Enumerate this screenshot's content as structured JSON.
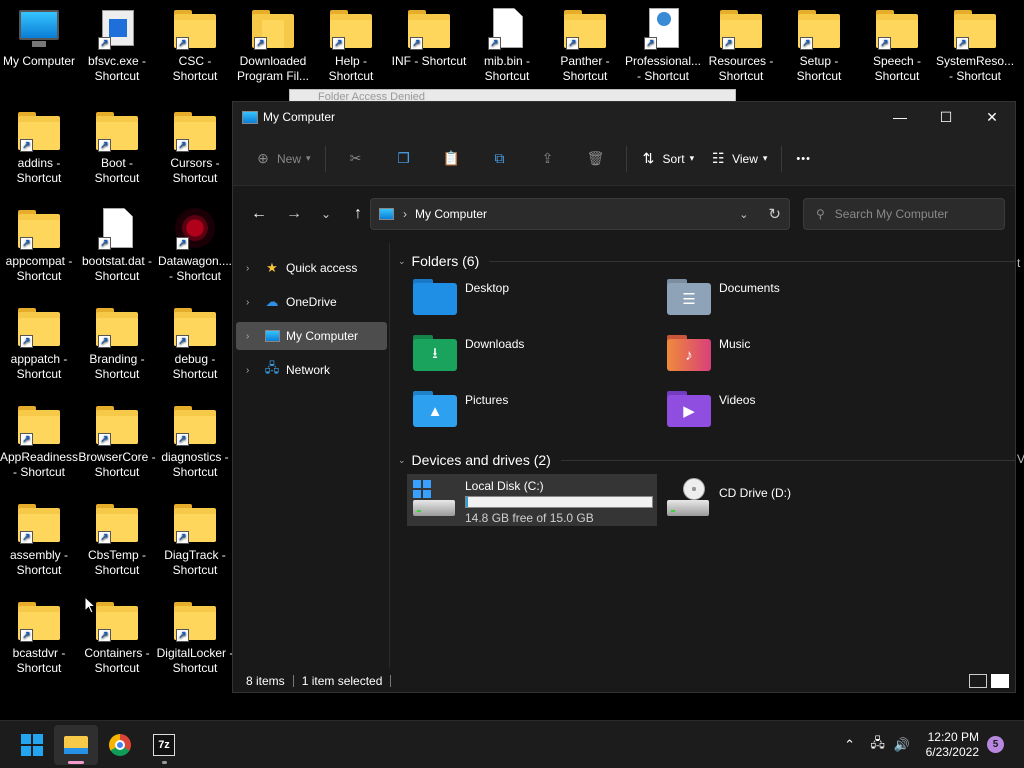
{
  "desktop": {
    "icons": [
      {
        "label": "My Computer",
        "type": "computer",
        "shortcut": false
      },
      {
        "label": "bfsvc.exe - Shortcut",
        "type": "exe",
        "shortcut": true
      },
      {
        "label": "CSC - Shortcut",
        "type": "folder",
        "shortcut": true
      },
      {
        "label": "Downloaded Program Fil...",
        "type": "folder-tall",
        "shortcut": true
      },
      {
        "label": "Help - Shortcut",
        "type": "folder",
        "shortcut": true
      },
      {
        "label": "INF - Shortcut",
        "type": "folder",
        "shortcut": true
      },
      {
        "label": "mib.bin - Shortcut",
        "type": "doc",
        "shortcut": true
      },
      {
        "label": "Panther - Shortcut",
        "type": "folder",
        "shortcut": true
      },
      {
        "label": "Professional... - Shortcut",
        "type": "webdoc",
        "shortcut": true
      },
      {
        "label": "Resources - Shortcut",
        "type": "folder",
        "shortcut": true
      },
      {
        "label": "Setup - Shortcut",
        "type": "folder",
        "shortcut": true
      },
      {
        "label": "Speech - Shortcut",
        "type": "folder",
        "shortcut": true
      },
      {
        "label": "SystemReso... - Shortcut",
        "type": "folder",
        "shortcut": true
      },
      {
        "label": "addins - Shortcut",
        "type": "folder",
        "shortcut": true
      },
      {
        "label": "Boot - Shortcut",
        "type": "folder",
        "shortcut": true
      },
      {
        "label": "Cursors - Shortcut",
        "type": "folder",
        "shortcut": true
      },
      {
        "label": "appcompat - Shortcut",
        "type": "folder",
        "shortcut": true
      },
      {
        "label": "bootstat.dat - Shortcut",
        "type": "doc",
        "shortcut": true
      },
      {
        "label": "Datawagon.... - Shortcut",
        "type": "datawagon",
        "shortcut": true
      },
      {
        "label": "apppatch - Shortcut",
        "type": "folder",
        "shortcut": true
      },
      {
        "label": "Branding - Shortcut",
        "type": "folder",
        "shortcut": true
      },
      {
        "label": "debug - Shortcut",
        "type": "folder",
        "shortcut": true
      },
      {
        "label": "AppReadiness - Shortcut",
        "type": "folder",
        "shortcut": true
      },
      {
        "label": "BrowserCore - Shortcut",
        "type": "folder",
        "shortcut": true
      },
      {
        "label": "diagnostics - Shortcut",
        "type": "folder",
        "shortcut": true
      },
      {
        "label": "assembly - Shortcut",
        "type": "folder",
        "shortcut": true
      },
      {
        "label": "CbsTemp - Shortcut",
        "type": "folder",
        "shortcut": true
      },
      {
        "label": "DiagTrack - Shortcut",
        "type": "folder",
        "shortcut": true
      },
      {
        "label": "bcastdvr - Shortcut",
        "type": "folder",
        "shortcut": true
      },
      {
        "label": "Containers - Shortcut",
        "type": "folder",
        "shortcut": true
      },
      {
        "label": "DigitalLocker - Shortcut",
        "type": "folder",
        "shortcut": true
      }
    ]
  },
  "bg_dialog": {
    "title": "Folder Access Denied"
  },
  "window": {
    "title": "My Computer",
    "controls": {
      "minimize": "—",
      "maximize": "☐",
      "close": "✕"
    }
  },
  "toolbar": {
    "new_label": "New",
    "sort_label": "Sort",
    "view_label": "View",
    "more_label": "•••"
  },
  "address": {
    "path": "My Computer",
    "separator": "›",
    "search_placeholder": "Search My Computer"
  },
  "nav": {
    "items": [
      {
        "label": "Quick access",
        "icon": "star-icon"
      },
      {
        "label": "OneDrive",
        "icon": "cloud-icon"
      },
      {
        "label": "My Computer",
        "icon": "computer-icon",
        "selected": true
      },
      {
        "label": "Network",
        "icon": "network-icon"
      }
    ]
  },
  "content": {
    "folders_header": "Folders (6)",
    "folders": [
      {
        "label": "Desktop",
        "color": "#1f8fe6",
        "glyph": ""
      },
      {
        "label": "Documents",
        "color": "#8ea3b8",
        "glyph": "☰"
      },
      {
        "label": "Downloads",
        "color": "#19a35c",
        "glyph": "⭳"
      },
      {
        "label": "Music",
        "color": "#e86a4a",
        "glyph": "♪"
      },
      {
        "label": "Pictures",
        "color": "#2ea0f0",
        "glyph": "▲"
      },
      {
        "label": "Videos",
        "color": "#8f4ee0",
        "glyph": "▶"
      }
    ],
    "drives_header": "Devices and drives (2)",
    "drives": [
      {
        "label": "Local Disk (C:)",
        "free_text": "14.8 GB free of 15.0 GB",
        "used_fraction": 0.013
      },
      {
        "label": "CD Drive (D:)"
      }
    ]
  },
  "status": {
    "items_count": "8 items",
    "selected_text": "1 item selected"
  },
  "edge_fragments": {
    "t": "t",
    "v": "V"
  },
  "taskbar": {
    "sevenzip_label": "7z",
    "time": "12:20 PM",
    "date": "6/23/2022",
    "notif_count": "5",
    "accent": "#f49cd0"
  }
}
